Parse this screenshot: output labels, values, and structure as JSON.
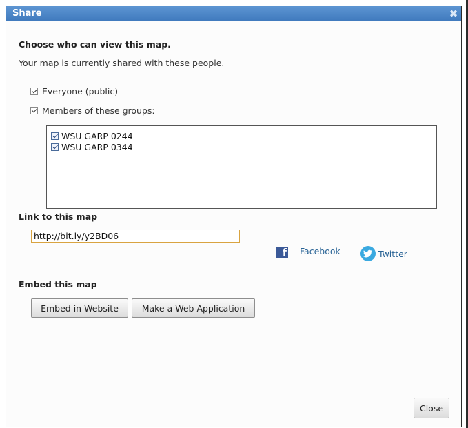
{
  "dialog": {
    "title": "Share",
    "close_icon": "close-x-icon"
  },
  "who": {
    "heading": "Choose who can view this map.",
    "subtext": "Your map is currently shared with these people.",
    "everyone_label": "Everyone (public)",
    "everyone_checked": true,
    "groups_label": "Members of these groups:",
    "groups_checked": true,
    "groups": [
      {
        "label": "WSU GARP 0244",
        "checked": true
      },
      {
        "label": "WSU GARP 0344",
        "checked": true
      }
    ]
  },
  "link": {
    "heading": "Link to this map",
    "url": "http://bit.ly/y2BD06",
    "facebook_label": "Facebook",
    "twitter_label": "Twitter"
  },
  "embed": {
    "heading": "Embed this map",
    "embed_website_label": "Embed in Website",
    "web_app_label": "Make a Web Application"
  },
  "footer": {
    "close_label": "Close"
  },
  "colors": {
    "titlebar": "#4a86c8",
    "link": "#2a6496",
    "facebook": "#3b5998",
    "twitter": "#3aa9e0"
  }
}
